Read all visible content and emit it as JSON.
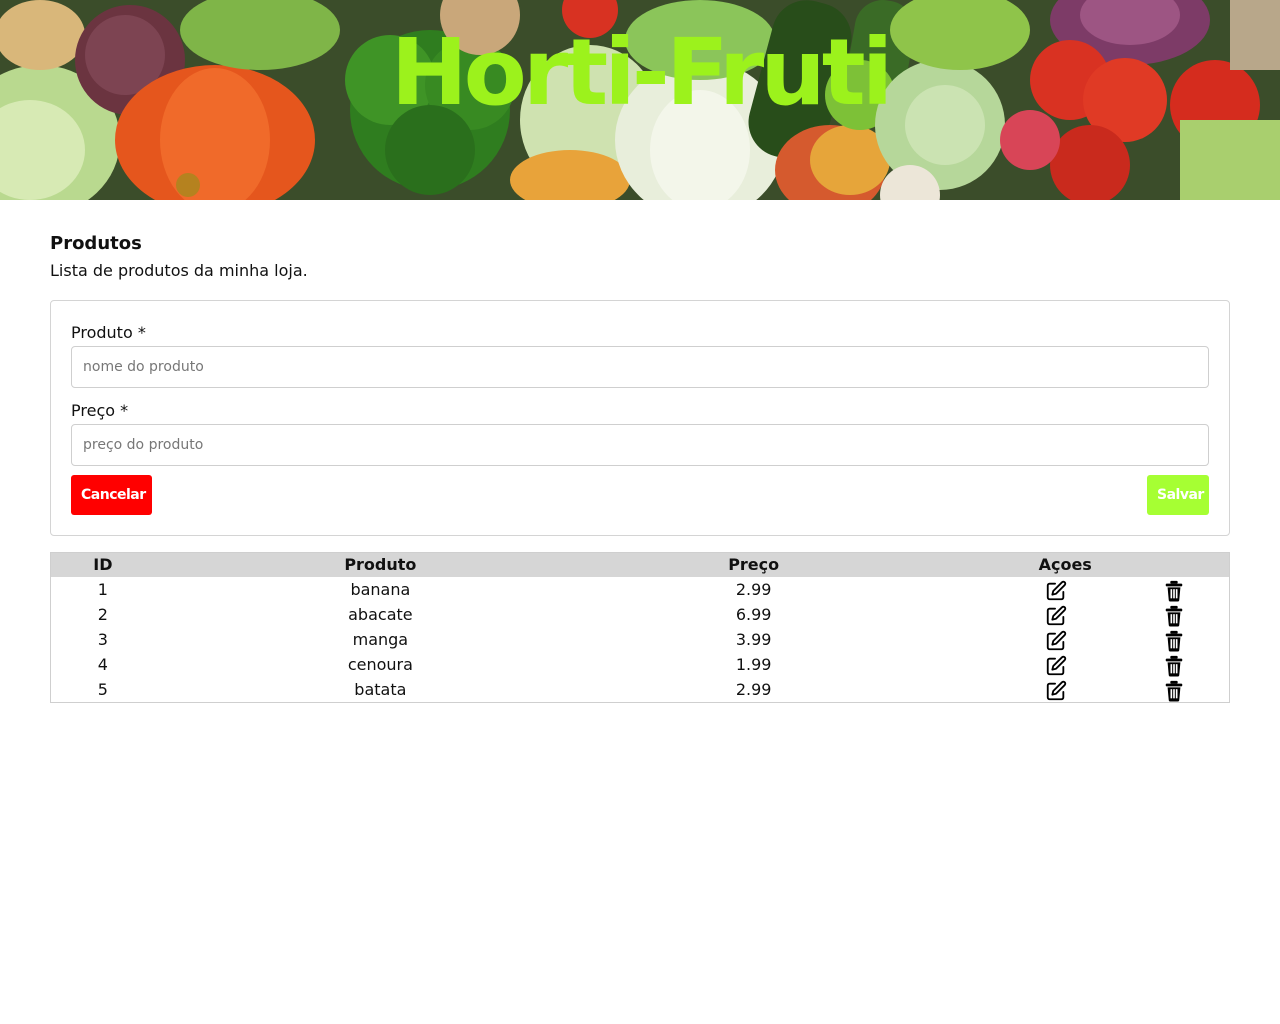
{
  "banner": {
    "title": "Horti-Fruti",
    "title_color": "#9cf21c"
  },
  "page": {
    "title": "Produtos",
    "subtitle": "Lista de produtos da minha loja."
  },
  "form": {
    "product_label": "Produto *",
    "product_placeholder": "nome do produto",
    "product_value": "",
    "price_label": "Preço *",
    "price_placeholder": "preço do produto",
    "price_value": "",
    "cancel_label": "Cancelar",
    "cancel_color": "#ff0000",
    "save_label": "Salvar",
    "save_color": "#a6ff33"
  },
  "table": {
    "headers": [
      "ID",
      "Produto",
      "Preço",
      "Açoes"
    ],
    "rows": [
      {
        "id": "1",
        "produto": "banana",
        "preco": "2.99"
      },
      {
        "id": "2",
        "produto": "abacate",
        "preco": "6.99"
      },
      {
        "id": "3",
        "produto": "manga",
        "preco": "3.99"
      },
      {
        "id": "4",
        "produto": "cenoura",
        "preco": "1.99"
      },
      {
        "id": "5",
        "produto": "batata",
        "preco": "2.99"
      }
    ],
    "row_actions": [
      "edit-icon",
      "trash-icon"
    ]
  }
}
